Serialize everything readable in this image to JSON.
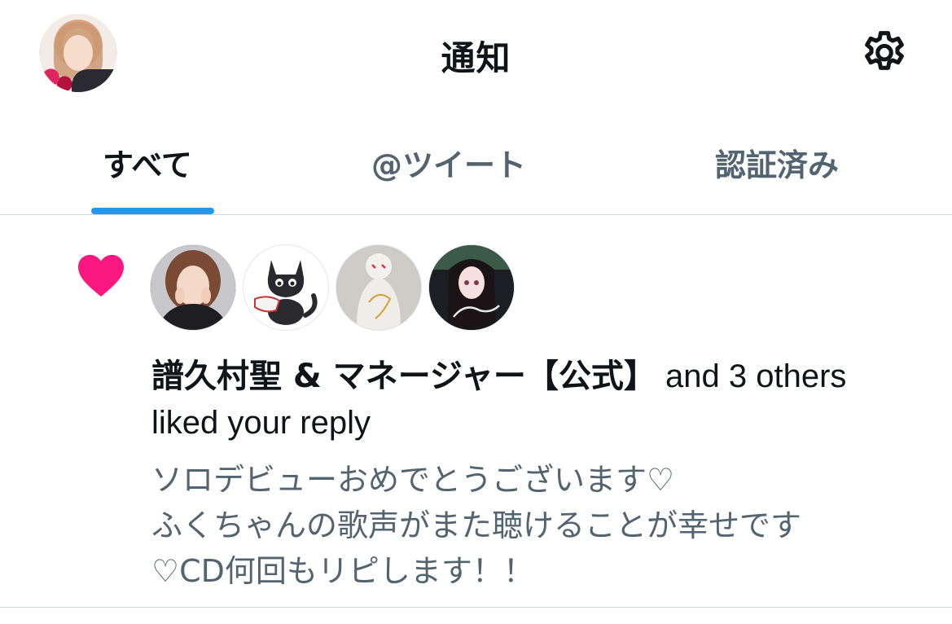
{
  "header": {
    "title": "通知",
    "avatar_icon": "profile-avatar",
    "settings_icon": "gear-icon"
  },
  "tabs": [
    {
      "label": "すべて",
      "active": true
    },
    {
      "label": "@ツイート",
      "active": false
    },
    {
      "label": "認証済み",
      "active": false
    }
  ],
  "colors": {
    "accent": "#1d9bf0",
    "like": "#f91880",
    "secondary_text": "#536471"
  },
  "notification": {
    "type_icon": "heart-icon",
    "user_name": "譜久村聖 & マネージャー【公式】",
    "summary_rest": " and 3 others",
    "action": "liked your reply",
    "reply_lines": [
      "ソロデビューおめでとうございます♡",
      "ふくちゃんの歌声がまた聴けることが幸せです",
      "♡CD何回もリピします！！"
    ]
  }
}
